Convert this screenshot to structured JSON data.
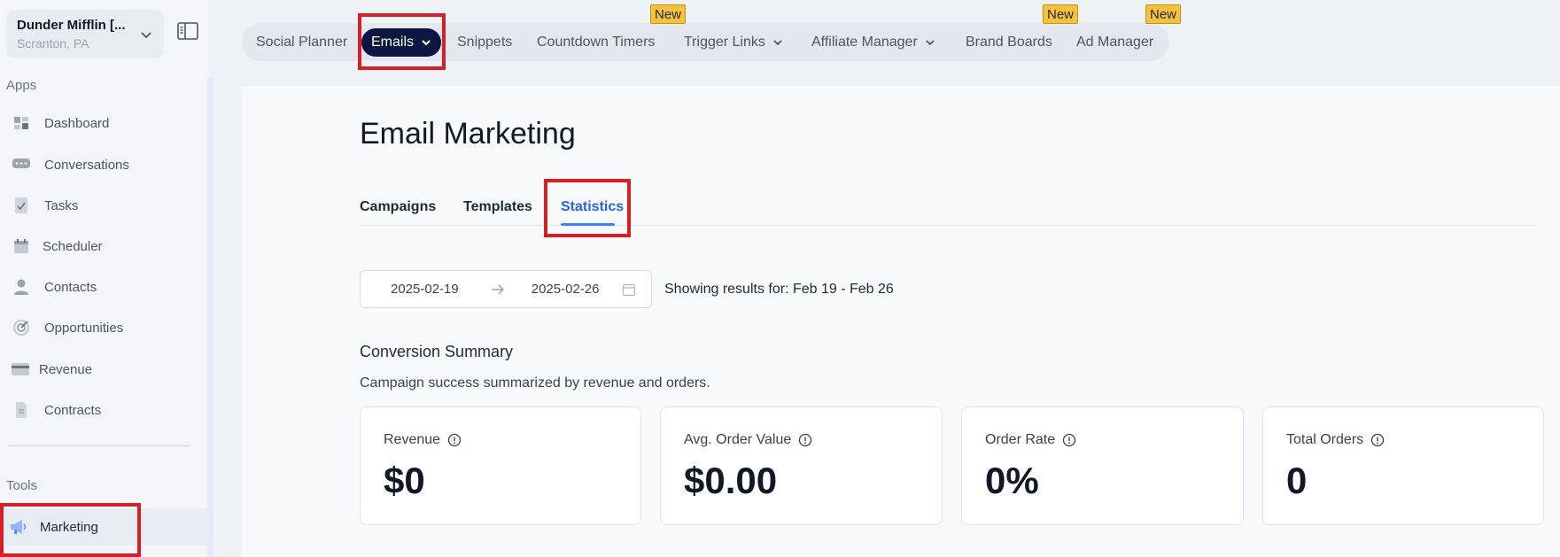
{
  "account": {
    "name": "Dunder Mifflin [...",
    "location": "Scranton, PA"
  },
  "sidebar": {
    "apps_label": "Apps",
    "items": [
      {
        "label": "Dashboard",
        "icon": "dashboard-icon"
      },
      {
        "label": "Conversations",
        "icon": "chat-icon"
      },
      {
        "label": "Tasks",
        "icon": "tasks-icon"
      },
      {
        "label": "Scheduler",
        "icon": "calendar-icon"
      },
      {
        "label": "Contacts",
        "icon": "person-icon"
      },
      {
        "label": "Opportunities",
        "icon": "target-icon"
      },
      {
        "label": "Revenue",
        "icon": "credit-card-icon"
      },
      {
        "label": "Contracts",
        "icon": "document-icon"
      }
    ],
    "tools_label": "Tools",
    "tools": [
      {
        "label": "Marketing",
        "icon": "megaphone-icon"
      }
    ]
  },
  "topnav": {
    "items": [
      {
        "label": "Social Planner"
      },
      {
        "label": "Emails"
      },
      {
        "label": "Snippets"
      },
      {
        "label": "Countdown Timers"
      },
      {
        "label": "Trigger Links"
      },
      {
        "label": "Affiliate Manager"
      },
      {
        "label": "Brand Boards"
      },
      {
        "label": "Ad Manager"
      }
    ],
    "new_badge": "New"
  },
  "page": {
    "title": "Email Marketing",
    "tabs": [
      {
        "label": "Campaigns"
      },
      {
        "label": "Templates"
      },
      {
        "label": "Statistics"
      }
    ],
    "date_start": "2025-02-19",
    "date_end": "2025-02-26",
    "results_text": "Showing results for: Feb 19 - Feb 26",
    "summary_title": "Conversion Summary",
    "summary_subtitle": "Campaign success summarized by revenue and orders.",
    "cards": [
      {
        "label": "Revenue",
        "value": "$0"
      },
      {
        "label": "Avg. Order Value",
        "value": "$0.00"
      },
      {
        "label": "Order Rate",
        "value": "0%"
      },
      {
        "label": "Total Orders",
        "value": "0"
      }
    ]
  },
  "colors": {
    "accent": "#2563eb",
    "active_pill": "#0b1741",
    "badge": "#f5c23a",
    "highlight": "#d71f26"
  }
}
